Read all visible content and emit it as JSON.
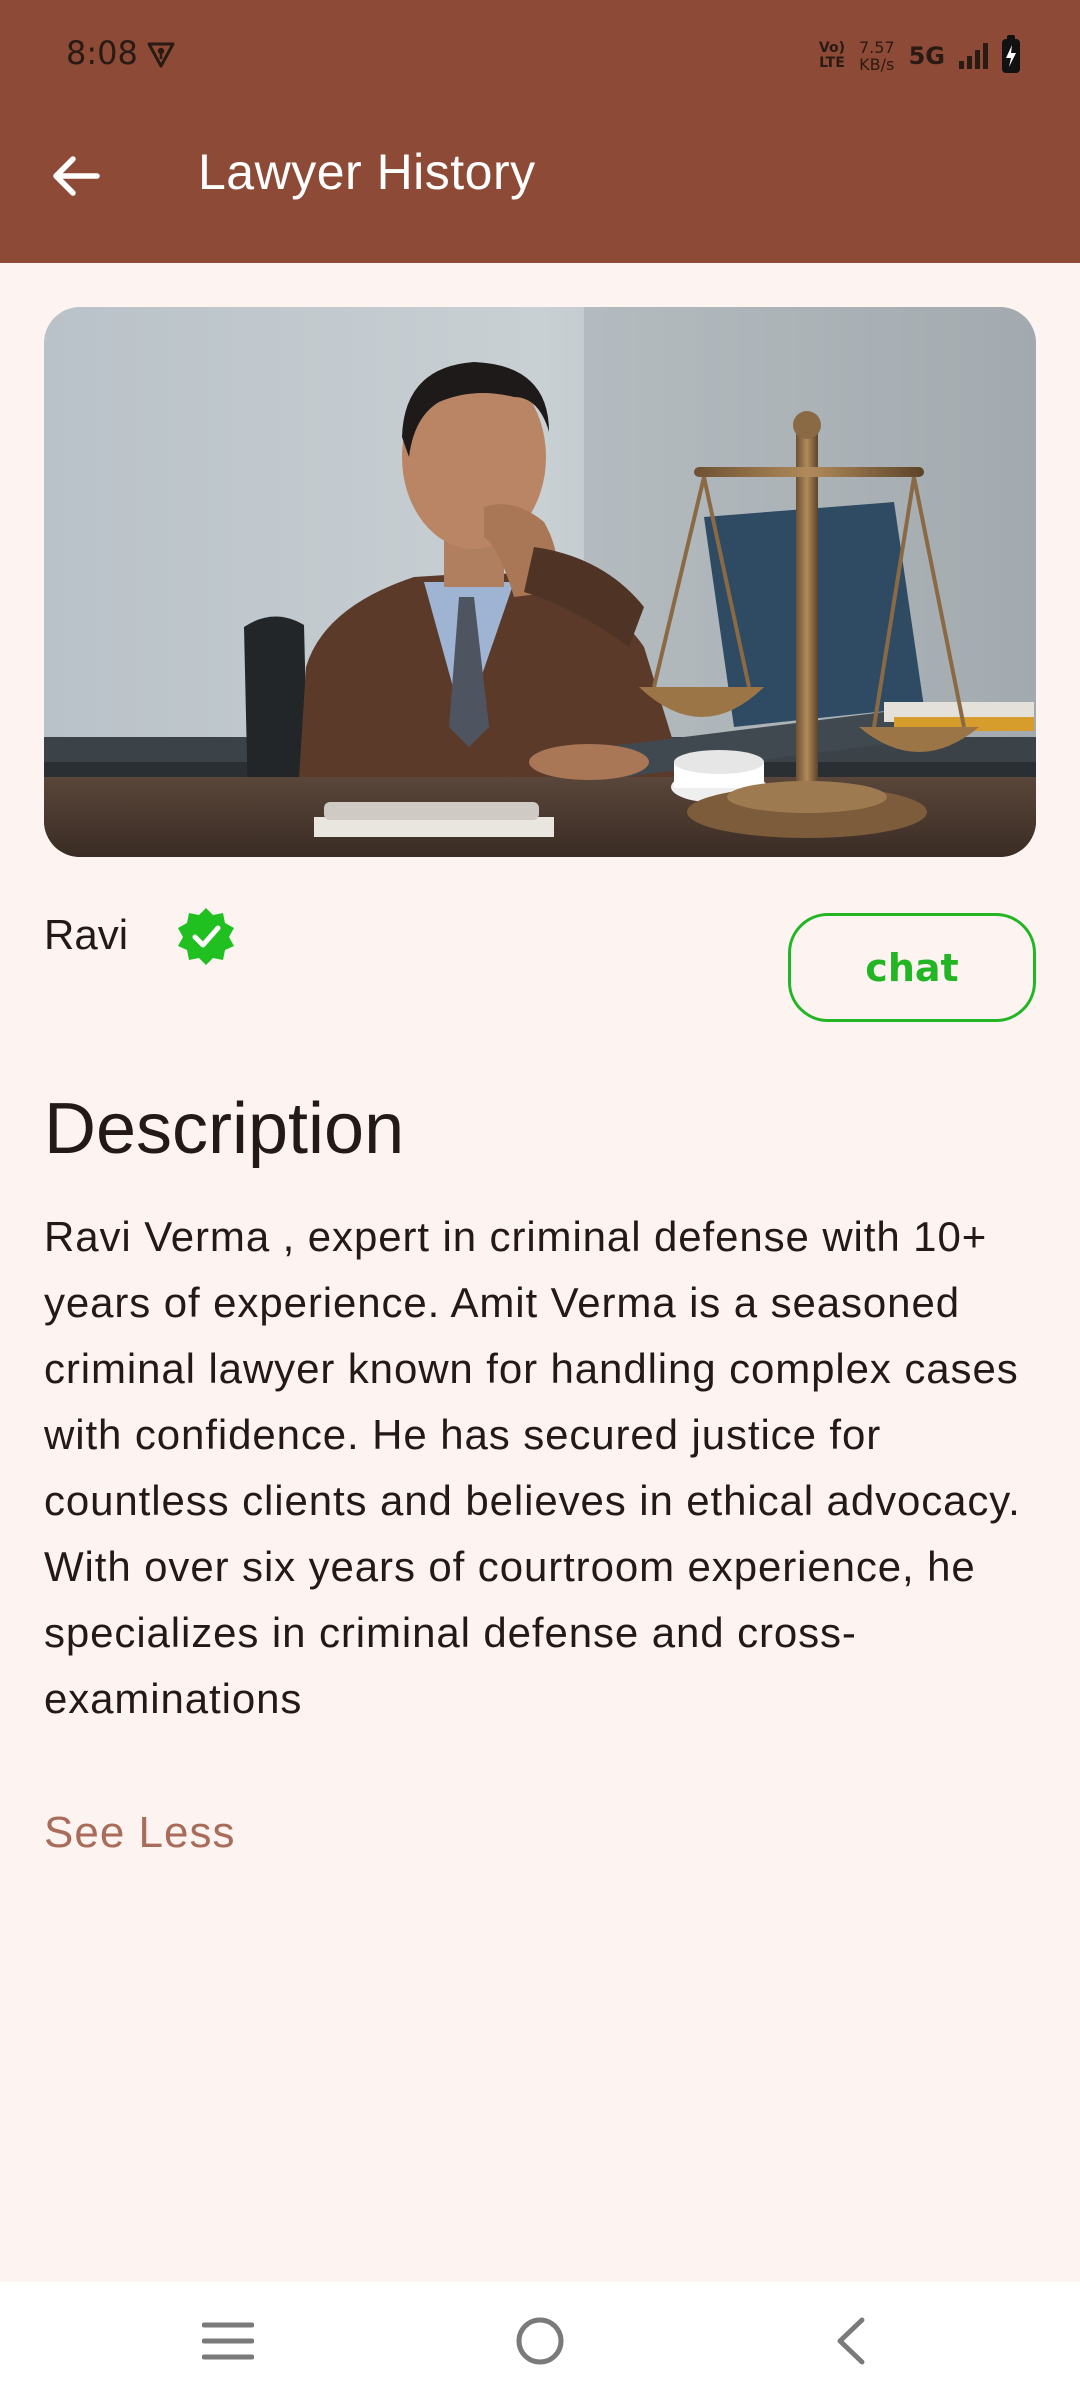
{
  "status_bar": {
    "time": "8:08",
    "volte": [
      "Vo)",
      "LTE"
    ],
    "net_speed": [
      "7.57",
      "KB/s"
    ],
    "network": "5G",
    "vpn_icon": "vpn-key-icon",
    "battery_icon": "battery-charging-icon"
  },
  "app_bar": {
    "title": "Lawyer History",
    "back_icon": "arrow-left-icon",
    "color": "#8d4a36"
  },
  "profile": {
    "photo": "lawyer-at-desk-with-scales-photo",
    "name": "Ravi",
    "verified_icon": "verified-badge-icon",
    "verified_color": "#21c021",
    "chat_label": "chat",
    "chat_color": "#22b624"
  },
  "description": {
    "heading": "Description",
    "text": "Ravi Verma , expert in criminal defense with 10+ years of experience. Amit Verma is a seasoned criminal lawyer known for handling complex cases with confidence. He has secured justice for countless clients and believes in ethical advocacy. With over six years of courtroom experience, he specializes in criminal defense and cross-examinations",
    "toggle_label": "See Less",
    "toggle_color": "#a96c5a"
  },
  "nav_bar": {
    "items": [
      "menu-icon",
      "home-circle-icon",
      "back-chevron-icon"
    ]
  }
}
